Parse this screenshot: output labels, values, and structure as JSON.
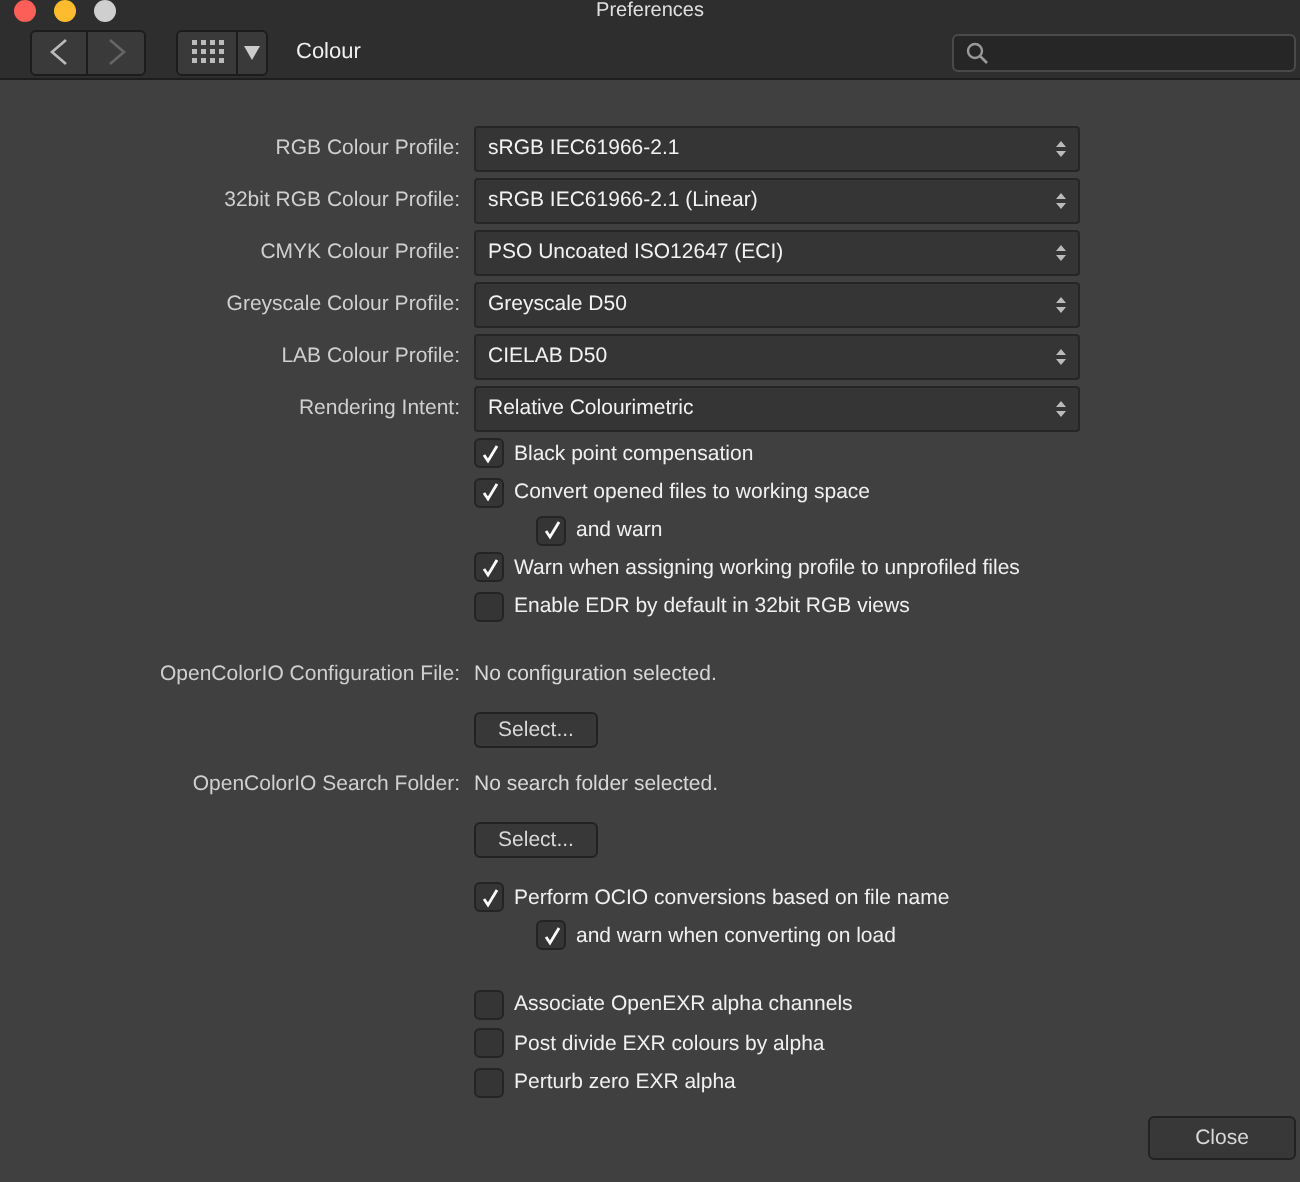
{
  "window": {
    "title": "Preferences"
  },
  "toolbar": {
    "section_title": "Colour"
  },
  "profiles": [
    {
      "label": "RGB Colour Profile:",
      "value": "sRGB IEC61966-2.1"
    },
    {
      "label": "32bit RGB Colour Profile:",
      "value": "sRGB IEC61966-2.1 (Linear)"
    },
    {
      "label": "CMYK Colour Profile:",
      "value": "PSO Uncoated ISO12647 (ECI)"
    },
    {
      "label": "Greyscale Colour Profile:",
      "value": "Greyscale D50"
    },
    {
      "label": "LAB Colour Profile:",
      "value": "CIELAB D50"
    },
    {
      "label": "Rendering Intent:",
      "value": "Relative Colourimetric"
    }
  ],
  "options": [
    {
      "label": "Black point compensation",
      "checked": true
    },
    {
      "label": "Convert opened files to working space",
      "checked": true,
      "children": [
        {
          "label": "and warn",
          "checked": true
        }
      ]
    },
    {
      "label": "Warn when assigning working profile to unprofiled files",
      "checked": true
    },
    {
      "label": "Enable EDR by default in 32bit RGB views",
      "checked": false
    }
  ],
  "ocio_config": {
    "label": "OpenColorIO Configuration File:",
    "value": "No configuration selected.",
    "button": "Select..."
  },
  "ocio_folder": {
    "label": "OpenColorIO Search Folder:",
    "value": "No search folder selected.",
    "button": "Select..."
  },
  "ocio_options": [
    {
      "label": "Perform OCIO conversions based on file name",
      "checked": true,
      "children": [
        {
          "label": "and warn when converting on load",
          "checked": true
        }
      ]
    }
  ],
  "exr_options": [
    {
      "label": "Associate OpenEXR alpha channels",
      "checked": false
    },
    {
      "label": "Post divide EXR colours by alpha",
      "checked": false
    },
    {
      "label": "Perturb zero EXR alpha",
      "checked": false
    }
  ],
  "close_button": "Close"
}
